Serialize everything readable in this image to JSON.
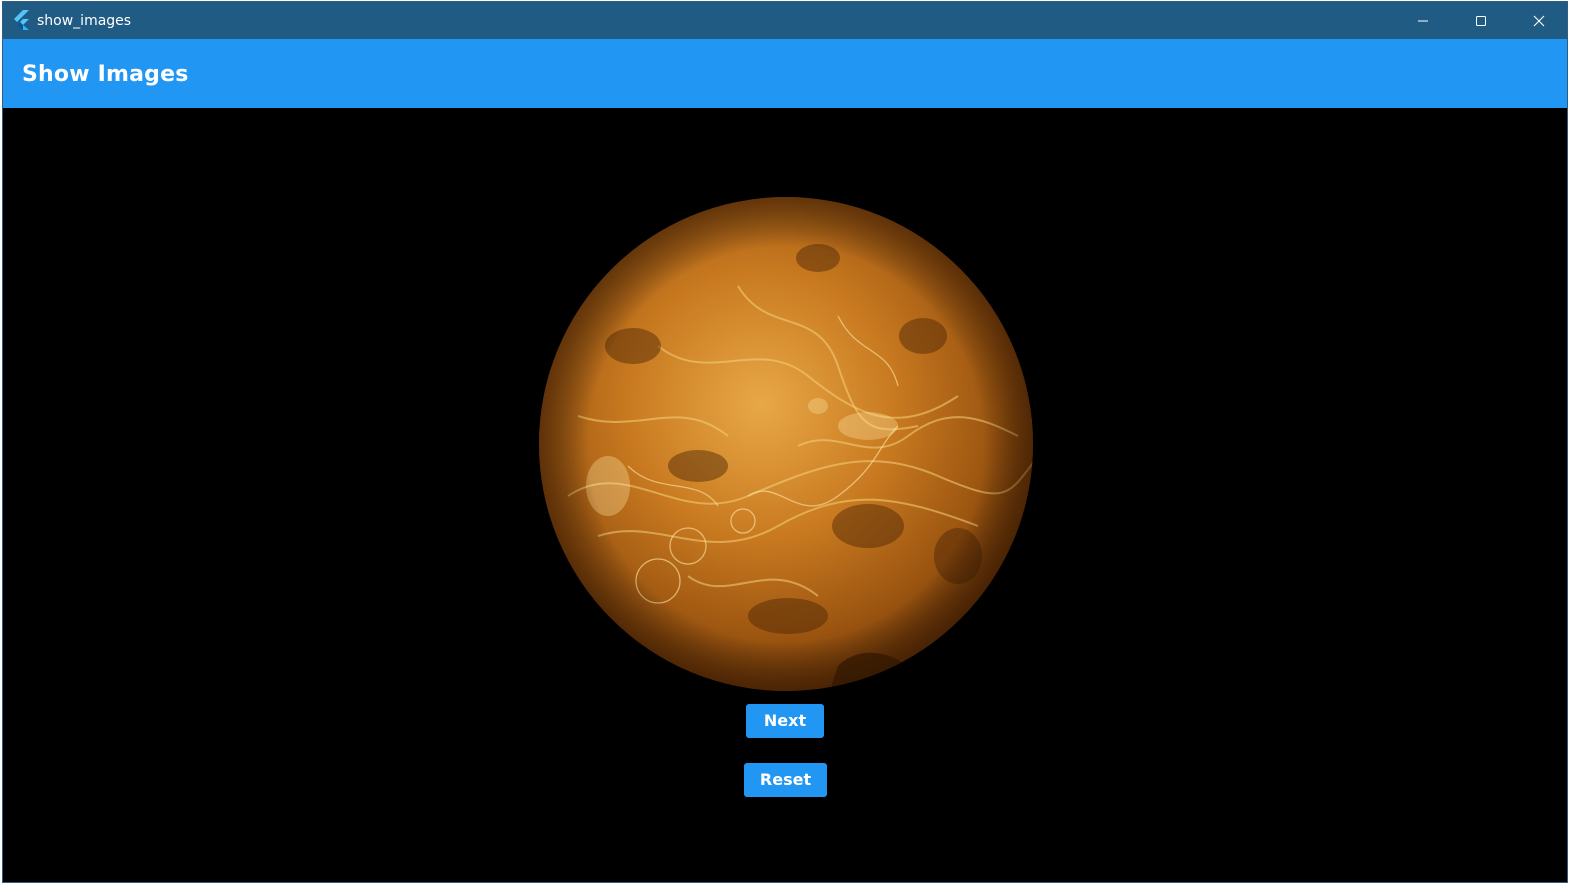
{
  "window": {
    "title": "show_images",
    "controls": {
      "minimize": "minimize-icon",
      "maximize": "maximize-icon",
      "close": "close-icon"
    }
  },
  "appbar": {
    "title": "Show Images",
    "color": "#2196f3"
  },
  "image": {
    "subject": "planet-venus-image"
  },
  "buttons": {
    "next_label": "Next",
    "reset_label": "Reset"
  },
  "colors": {
    "titlebar": "#205b84",
    "accent": "#2196f3",
    "background": "#000000"
  }
}
